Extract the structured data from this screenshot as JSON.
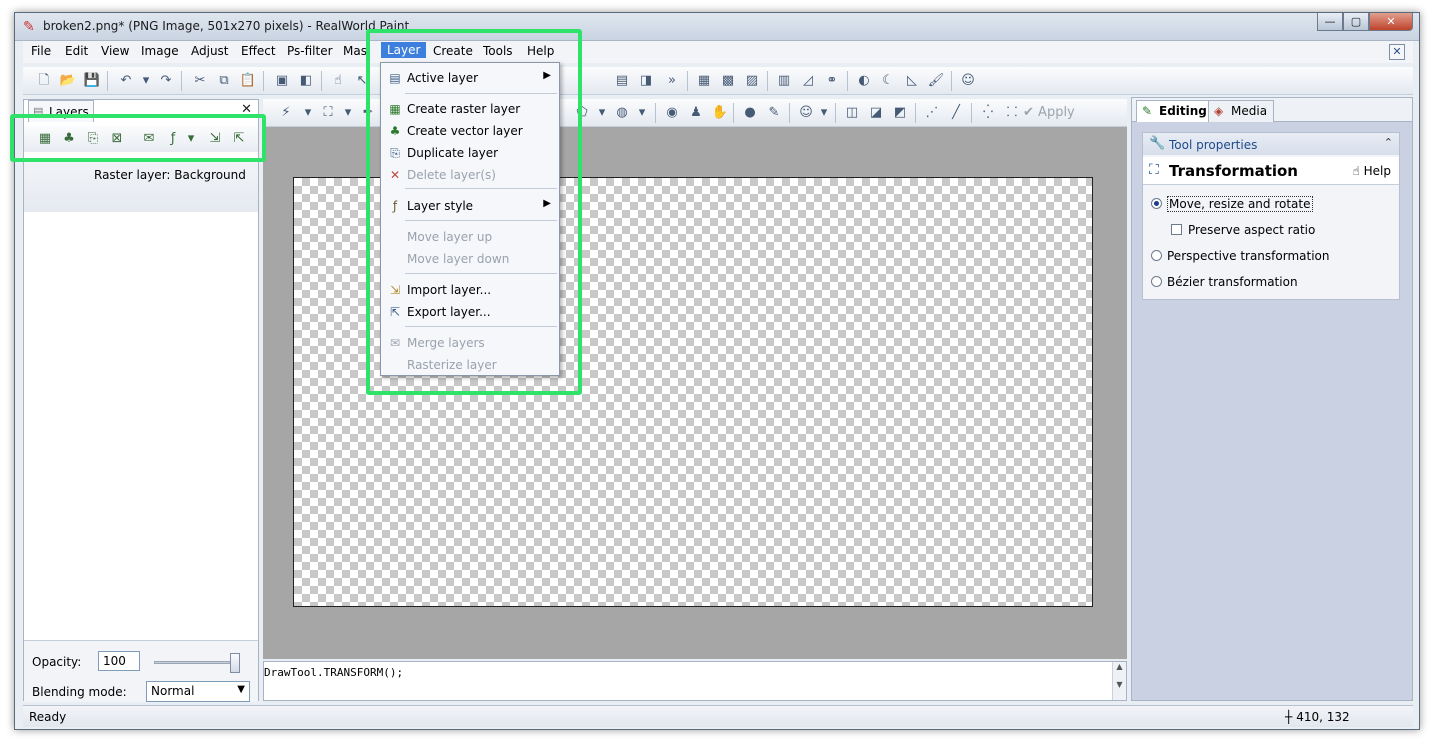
{
  "window": {
    "title": "broken2.png* (PNG Image, 501x270 pixels) - RealWorld Paint",
    "app_icon": "paint-icon",
    "controls": {
      "minimize": "—",
      "maximize": "▢",
      "close": "✕"
    }
  },
  "menubar": {
    "items": [
      "File",
      "Edit",
      "View",
      "Image",
      "Adjust",
      "Effect",
      "Ps-filter",
      "Mas",
      "Layer",
      "Create",
      "Tools",
      "Help"
    ],
    "active": "Layer",
    "mdi_close": "✕"
  },
  "layers_panel": {
    "tab_label": "Layers",
    "close": "✕",
    "layer_name": "Raster layer: Background",
    "opacity_label": "Opacity:",
    "opacity_value": "100",
    "opacity_level": 1.0,
    "blending_label": "Blending mode:",
    "blending_value": "Normal"
  },
  "toolbar2": {
    "apply_label": "Apply"
  },
  "layer_menu": {
    "items": [
      {
        "label": "Active layer",
        "icon": "layer-stack-icon",
        "submenu": true,
        "disabled": false
      },
      {
        "label": "Create raster layer",
        "icon": "raster-grid-icon",
        "disabled": false
      },
      {
        "label": "Create vector layer",
        "icon": "vector-tree-icon",
        "disabled": false
      },
      {
        "label": "Duplicate layer",
        "icon": "duplicate-layer-icon",
        "disabled": false
      },
      {
        "label": "Delete layer(s)",
        "icon": "delete-layer-icon",
        "disabled": true
      },
      {
        "label": "Layer style",
        "icon": "fx-icon",
        "submenu": true,
        "disabled": false
      },
      {
        "label": "Move layer up",
        "disabled": true
      },
      {
        "label": "Move layer down",
        "disabled": true
      },
      {
        "label": "Import layer...",
        "icon": "import-layer-icon",
        "disabled": false
      },
      {
        "label": "Export layer...",
        "icon": "export-layer-icon",
        "disabled": false
      },
      {
        "label": "Merge layers",
        "icon": "merge-layers-icon",
        "disabled": true
      },
      {
        "label": "Rasterize layer",
        "disabled": true
      }
    ]
  },
  "script": {
    "text": "DrawTool.TRANSFORM();"
  },
  "right_panel": {
    "tabs": [
      "Editing",
      "Media"
    ],
    "active_tab": "Editing",
    "tool_properties": "Tool properties",
    "tool_name": "Transformation",
    "help_label": "Help",
    "options": [
      {
        "label": "Move, resize and rotate",
        "type": "radio",
        "checked": true
      },
      {
        "label": "Preserve aspect ratio",
        "type": "checkbox",
        "checked": false
      },
      {
        "label": "Perspective transformation",
        "type": "radio",
        "checked": false
      },
      {
        "label": "Bézier transformation",
        "type": "radio",
        "checked": false
      }
    ]
  },
  "status": {
    "text": "Ready",
    "coords": "410, 132"
  },
  "colors": {
    "highlight": "#2ee26a",
    "menu_active": "#3c7fdc",
    "canvas_bg": "#a6a6a6"
  }
}
